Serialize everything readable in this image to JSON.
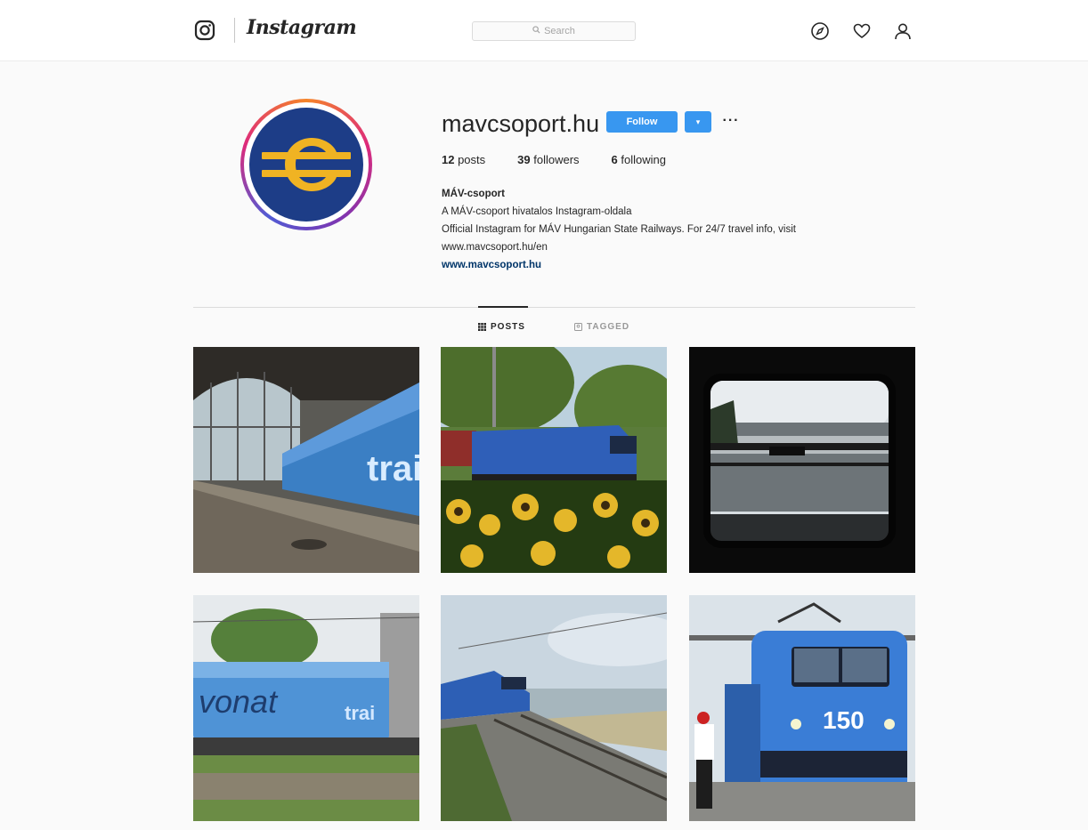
{
  "nav": {
    "wordmark": "Instagram",
    "search_placeholder": "Search",
    "icons": [
      "instagram-glyph-icon",
      "compass-icon",
      "heart-icon",
      "user-icon"
    ]
  },
  "profile": {
    "username": "mavcsoport.hu",
    "follow_label": "Follow",
    "dropdown_label": "▾",
    "more_label": "···",
    "stats": {
      "posts_count": "12",
      "posts_label": " posts",
      "followers_count": "39",
      "followers_label": " followers",
      "following_count": "6",
      "following_label": " following"
    },
    "bio": {
      "name": "MÁV-csoport",
      "line1": "A MÁV-csoport hivatalos Instagram-oldala",
      "line2": "Official Instagram for MÁV Hungarian State Railways. For 24/7 travel info, visit",
      "line3": "www.mavcsoport.hu/en",
      "link": "www.mavcsoport.hu"
    },
    "avatar_colors": {
      "navy": "#1d3d87",
      "gold": "#f0b323"
    }
  },
  "tabs": [
    {
      "label": "POSTS",
      "active": true
    },
    {
      "label": "TAGGED",
      "active": false
    }
  ],
  "posts": [
    {
      "name": "post-station-train",
      "scene": "blue train in station hall"
    },
    {
      "name": "post-sunflower-train",
      "scene": "blue locomotive behind sunflowers"
    },
    {
      "name": "post-window-lake",
      "scene": "lake view through train window"
    },
    {
      "name": "post-vonat-train",
      "scene": "graffiti locomotive"
    },
    {
      "name": "post-lakeside-rail",
      "scene": "train on lakeside railway"
    },
    {
      "name": "post-150-locomotive",
      "scene": "locomotive with 150 marking"
    }
  ],
  "post_texts": {
    "tile1_text": "trai",
    "tile4_text": "vonat",
    "tile4_text2": "trai",
    "tile6_text": "150"
  },
  "colors": {
    "accent": "#3897f0",
    "link": "#003569",
    "train_blue": "#2a6bd1"
  }
}
